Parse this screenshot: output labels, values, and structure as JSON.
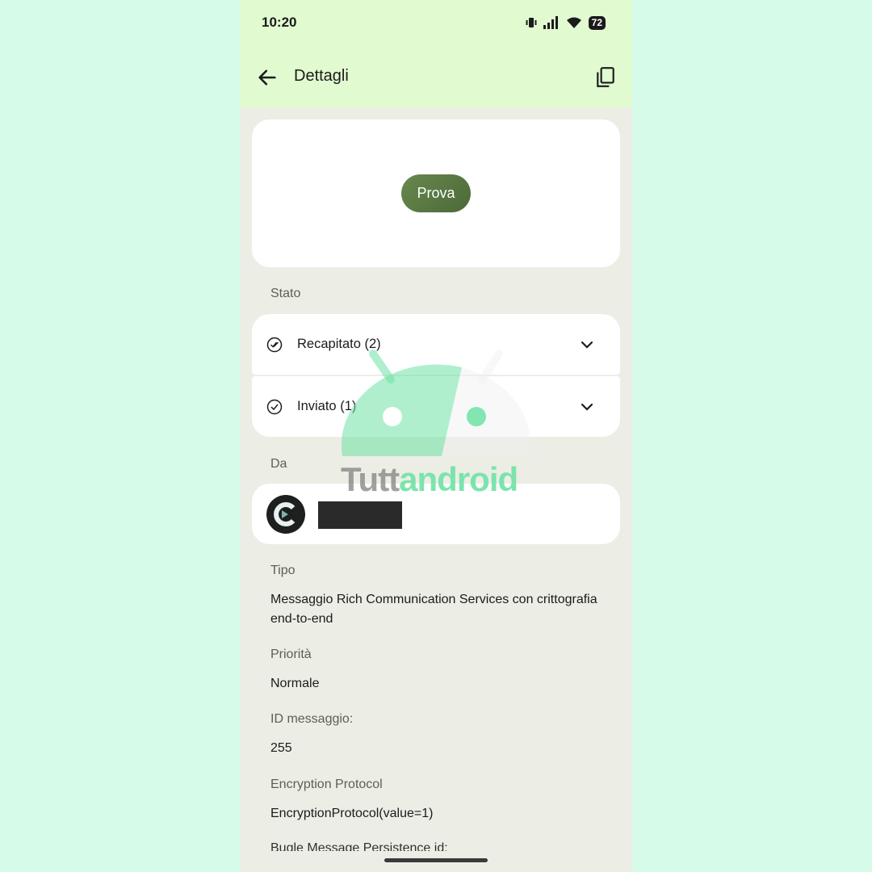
{
  "status_bar": {
    "time": "10:20",
    "battery": "72",
    "icons": [
      "vibrate-icon",
      "signal-icon",
      "wifi-icon",
      "battery-icon"
    ]
  },
  "header": {
    "title": "Dettagli",
    "back_icon": "arrow-left-icon",
    "copy_icon": "copy-icon"
  },
  "message_preview": {
    "text": "Prova"
  },
  "status_section": {
    "label": "Stato",
    "rows": [
      {
        "label": "Recapitato (2)",
        "icon": "double-check-circle-icon"
      },
      {
        "label": "Inviato (1)",
        "icon": "check-circle-icon"
      }
    ]
  },
  "from_section": {
    "label": "Da",
    "avatar_icon": "contact-avatar-icon"
  },
  "details": [
    {
      "label": "Tipo",
      "value": "Messaggio Rich Communication Services con crittografia end-to-end"
    },
    {
      "label": "Priorità",
      "value": "Normale"
    },
    {
      "label": "ID messaggio:",
      "value": "255"
    },
    {
      "label": "Encryption Protocol",
      "value": "EncryptionProtocol(value=1)"
    }
  ],
  "cut_off_label": "Bugle Message Persistence id:",
  "watermark": {
    "part1": "Tutt",
    "part2": "android"
  },
  "colors": {
    "page_bg": "#d6fbe9",
    "app_bg": "#ecede5",
    "topbar_bg": "#e1fad0",
    "bubble": "#5d7b45",
    "watermark_green": "#6ee2a5"
  }
}
